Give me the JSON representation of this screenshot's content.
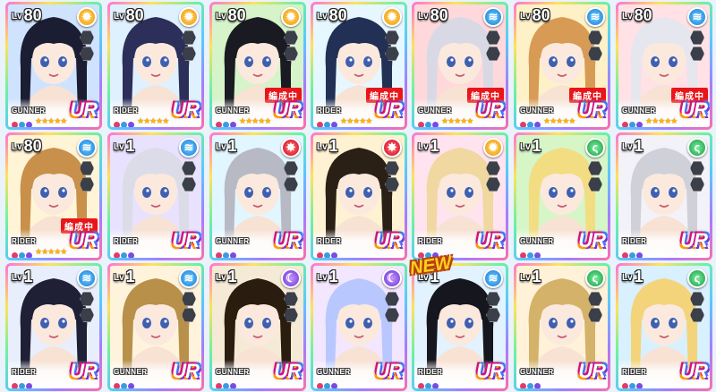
{
  "rarity_label": "UR",
  "lv_prefix": "Lv",
  "new_label": "NEW",
  "colors": {
    "sun": "#f29a00",
    "water": "#1678d8",
    "fire": "#d4001c",
    "wind": "#119a3e",
    "moon": "#6b2fd0"
  },
  "cards": [
    {
      "lv": "80",
      "attr": "sun",
      "icon": "sun-icon",
      "role": "GUNNER",
      "stars": 5,
      "tag": "",
      "hair": "#1b1d33",
      "bg": "#cfe3ff"
    },
    {
      "lv": "80",
      "attr": "sun",
      "icon": "sun-icon",
      "role": "RIDER",
      "stars": 5,
      "tag": "",
      "hair": "#2b2f5a",
      "bg": "#dff0ff"
    },
    {
      "lv": "80",
      "attr": "sun",
      "icon": "sun-icon",
      "role": "GUNNER",
      "stars": 5,
      "tag": "編成中",
      "hair": "#1a1a22",
      "bg": "#d6f3c9"
    },
    {
      "lv": "80",
      "attr": "sun",
      "icon": "sun-icon",
      "role": "RIDER",
      "stars": 5,
      "tag": "編成中",
      "hair": "#223055",
      "bg": "#e6f7ff"
    },
    {
      "lv": "80",
      "attr": "water",
      "icon": "water-icon",
      "role": "GUNNER",
      "stars": 5,
      "tag": "編成中",
      "hair": "#d9d9e6",
      "bg": "#ffd8dc"
    },
    {
      "lv": "80",
      "attr": "water",
      "icon": "water-icon",
      "role": "GUNNER",
      "stars": 5,
      "tag": "編成中",
      "hair": "#d89b55",
      "bg": "#fff1c7"
    },
    {
      "lv": "80",
      "attr": "water",
      "icon": "water-icon",
      "role": "GUNNER",
      "stars": 5,
      "tag": "編成中",
      "hair": "#e6e6ee",
      "bg": "#ffe1e6"
    },
    {
      "lv": "80",
      "attr": "water",
      "icon": "water-icon",
      "role": "RIDER",
      "stars": 5,
      "tag": "編成中",
      "hair": "#c8904a",
      "bg": "#fff4d6"
    },
    {
      "lv": "1",
      "attr": "water",
      "icon": "water-icon",
      "role": "RIDER",
      "stars": 0,
      "tag": "",
      "hair": "#dcdce8",
      "bg": "#e9e2ff"
    },
    {
      "lv": "1",
      "attr": "fire",
      "icon": "fire-icon",
      "role": "GUNNER",
      "stars": 0,
      "tag": "",
      "hair": "#b7b9c4",
      "bg": "#e2f6ff"
    },
    {
      "lv": "1",
      "attr": "fire",
      "icon": "fire-icon",
      "role": "RIDER",
      "stars": 0,
      "tag": "",
      "hair": "#2a2016",
      "bg": "#fff2d2"
    },
    {
      "lv": "1",
      "attr": "sun",
      "icon": "sun-icon",
      "role": "RIDER",
      "stars": 0,
      "tag": "",
      "hair": "#f0d8a0",
      "bg": "#ffe3ef"
    },
    {
      "lv": "1",
      "attr": "wind",
      "icon": "wind-icon",
      "role": "GUNNER",
      "stars": 0,
      "tag": "",
      "hair": "#f2dd82",
      "bg": "#d6f6c8"
    },
    {
      "lv": "1",
      "attr": "wind",
      "icon": "wind-icon",
      "role": "RIDER",
      "stars": 0,
      "tag": "",
      "hair": "#cfd0d8",
      "bg": "#f2f2f8"
    },
    {
      "lv": "1",
      "attr": "water",
      "icon": "water-icon",
      "role": "RIDER",
      "stars": 0,
      "tag": "",
      "hair": "#1f2036",
      "bg": "#e8eefc"
    },
    {
      "lv": "1",
      "attr": "water",
      "icon": "water-icon",
      "role": "GUNNER",
      "stars": 0,
      "tag": "",
      "hair": "#b8904a",
      "bg": "#fff3dc"
    },
    {
      "lv": "1",
      "attr": "moon",
      "icon": "moon-icon",
      "role": "GUNNER",
      "stars": 0,
      "tag": "",
      "hair": "#2a1d10",
      "bg": "#f4ead6"
    },
    {
      "lv": "1",
      "attr": "moon",
      "icon": "moon-icon",
      "role": "GUNNER",
      "stars": 0,
      "tag": "",
      "hair": "#b9c7ff",
      "bg": "#f3e6ff"
    },
    {
      "lv": "1",
      "attr": "water",
      "icon": "water-icon",
      "role": "RIDER",
      "stars": 0,
      "tag": "",
      "hair": "#16161e",
      "bg": "#e3f2ff"
    },
    {
      "lv": "1",
      "attr": "wind",
      "icon": "wind-icon",
      "role": "GUNNER",
      "stars": 0,
      "tag": "",
      "hair": "#d4b26a",
      "bg": "#fff2d8"
    },
    {
      "lv": "1",
      "attr": "wind",
      "icon": "wind-icon",
      "role": "RIDER",
      "stars": 0,
      "tag": "",
      "hair": "#f3d47a",
      "bg": "#d9f0ff"
    }
  ]
}
